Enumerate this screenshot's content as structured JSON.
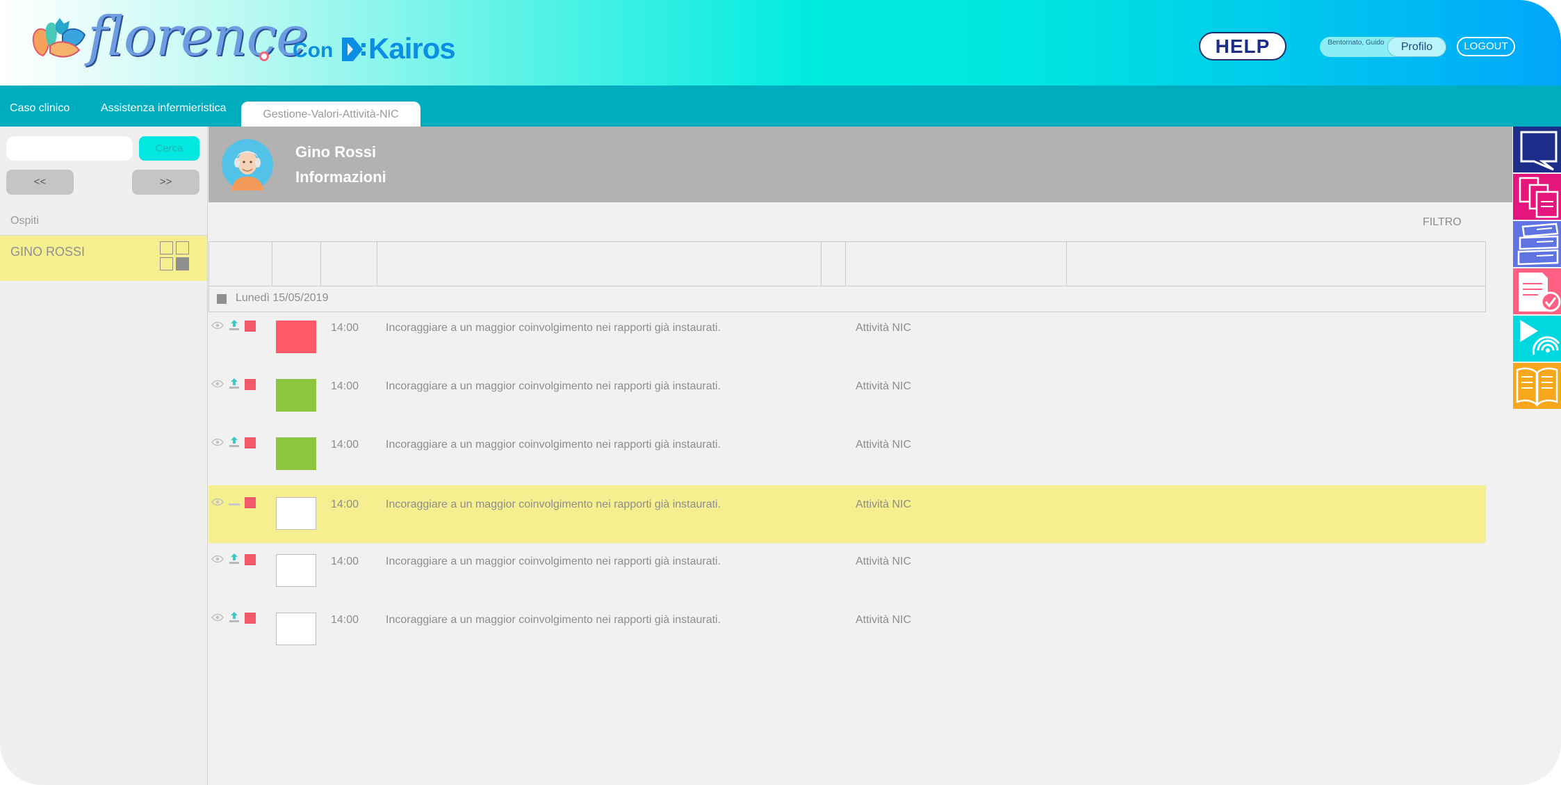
{
  "brand": {
    "logo_text": "florence",
    "connector": "Con",
    "partner_text": "Kairos"
  },
  "header": {
    "help_label": "HELP",
    "welcome_text": "Bentornato, Guido",
    "profile_label": "Profilo",
    "logout_label": "LOGOUT"
  },
  "tabs": [
    {
      "label": "Caso clinico",
      "active": false
    },
    {
      "label": "Assistenza infermieristica",
      "active": false
    },
    {
      "label": "Gestione-Valori-Attività-NIC",
      "active": true
    }
  ],
  "sidebar": {
    "search_value": "",
    "search_button": "Cerca",
    "prev_label": "<<",
    "next_label": ">>",
    "section_label": "Ospiti",
    "guests": [
      {
        "name": "GINO ROSSI"
      }
    ]
  },
  "patient": {
    "name": "Gino Rossi",
    "subtitle": "Informazioni"
  },
  "main": {
    "filter_label": "FILTRO",
    "date_label": "Lunedì 15/05/2019",
    "rows": [
      {
        "status": "red",
        "time": "14:00",
        "description": "Incoraggiare a un maggior coinvolgimento nei rapporti già instaurati.",
        "type": "Attività NIC",
        "highlight": false,
        "upload": true
      },
      {
        "status": "green",
        "time": "14:00",
        "description": "Incoraggiare a un maggior coinvolgimento nei rapporti già instaurati.",
        "type": "Attività NIC",
        "highlight": false,
        "upload": true
      },
      {
        "status": "green",
        "time": "14:00",
        "description": "Incoraggiare a un maggior coinvolgimento nei rapporti già instaurati.",
        "type": "Attività NIC",
        "highlight": false,
        "upload": true
      },
      {
        "status": "white",
        "time": "14:00",
        "description": "Incoraggiare a un maggior coinvolgimento nei rapporti già instaurati.",
        "type": "Attività NIC",
        "highlight": true,
        "upload": false
      },
      {
        "status": "white",
        "time": "14:00",
        "description": "Incoraggiare a un maggior coinvolgimento nei rapporti già instaurati.",
        "type": "Attività NIC",
        "highlight": false,
        "upload": true
      },
      {
        "status": "white",
        "time": "14:00",
        "description": "Incoraggiare a un maggior coinvolgimento nei rapporti già instaurati.",
        "type": "Attività NIC",
        "highlight": false,
        "upload": true
      }
    ]
  },
  "right_rail": [
    {
      "icon": "chat-icon",
      "color": "#1d2d8a"
    },
    {
      "icon": "documents-icon",
      "color": "#e5157e"
    },
    {
      "icon": "files-stack-icon",
      "color": "#5f74e2"
    },
    {
      "icon": "checked-report-icon",
      "color": "#ff5f83"
    },
    {
      "icon": "play-wireless-icon",
      "color": "#00d7df"
    },
    {
      "icon": "open-book-icon",
      "color": "#f7a71b"
    }
  ],
  "colors": {
    "status_red": "#ff5b66",
    "status_green": "#8cc63e",
    "status_white": "#ffffff",
    "highlight": "#f5ef8f",
    "tabbar": "#00adbf",
    "accent_cyan": "#00e8e0"
  }
}
